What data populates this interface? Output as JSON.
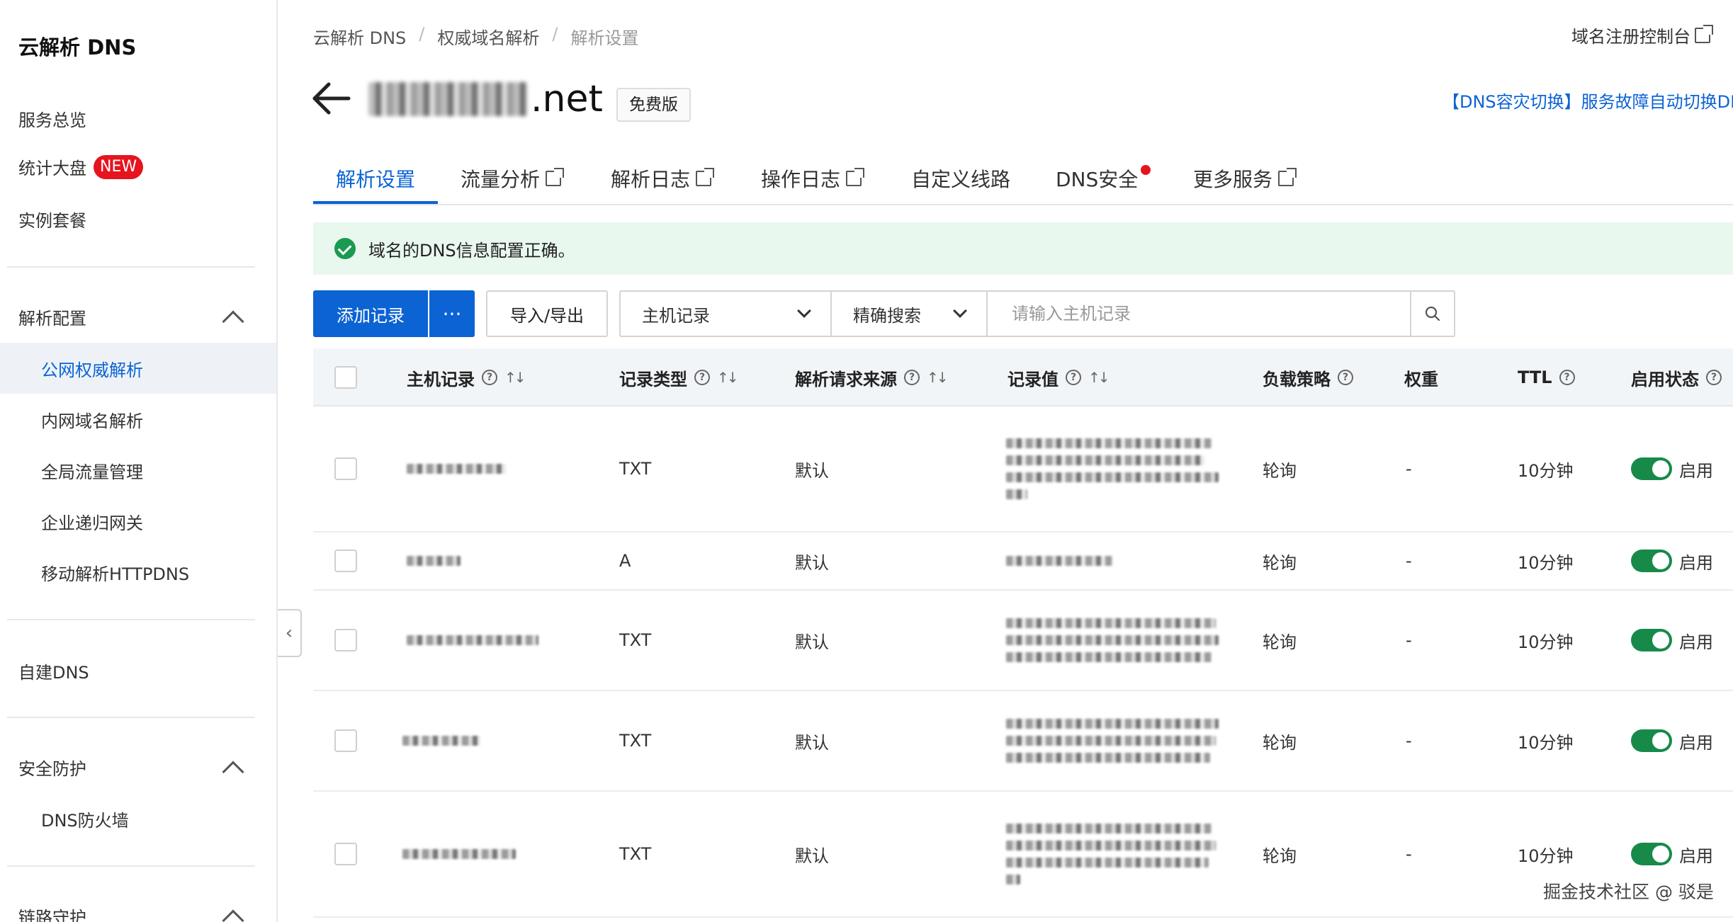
{
  "sidebar": {
    "title": "云解析 DNS",
    "top_items": [
      {
        "label": "服务总览"
      },
      {
        "label": "统计大盘",
        "badge": "NEW"
      },
      {
        "label": "实例套餐"
      }
    ],
    "group_resolve": {
      "label": "解析配置",
      "items": [
        "公网权威解析",
        "内网域名解析",
        "全局流量管理",
        "企业递归网关",
        "移动解析HTTPDNS"
      ],
      "active": "公网权威解析"
    },
    "self_dns": "自建DNS",
    "group_security": {
      "label": "安全防护",
      "items": [
        "DNS防火墙"
      ]
    },
    "group_link": {
      "label": "链路守护"
    }
  },
  "breadcrumb": [
    "云解析 DNS",
    "权威域名解析",
    "解析设置"
  ],
  "header": {
    "top_link": "域名注册控制台",
    "domain_suffix": ".net",
    "edition": "免费版",
    "promo": "【DNS容灾切换】服务故障自动切换DNS"
  },
  "tabs": [
    {
      "label": "解析设置",
      "active": true
    },
    {
      "label": "流量分析",
      "external": true
    },
    {
      "label": "解析日志",
      "external": true
    },
    {
      "label": "操作日志",
      "external": true
    },
    {
      "label": "自定义线路"
    },
    {
      "label": "DNS安全",
      "dot": true
    },
    {
      "label": "更多服务",
      "external": true
    }
  ],
  "alert": {
    "text": "域名的DNS信息配置正确。",
    "status_color": "#1a9a50"
  },
  "toolbar": {
    "add_label": "添加记录",
    "more_label": "···",
    "import_export_label": "导入/导出",
    "field_select": "主机记录",
    "mode_select": "精确搜索",
    "search_placeholder": "请输入主机记录"
  },
  "table": {
    "headers": {
      "host": "主机记录",
      "type": "记录类型",
      "source": "解析请求来源",
      "value": "记录值",
      "policy": "负载策略",
      "weight": "权重",
      "ttl": "TTL",
      "status": "启用状态"
    },
    "rows": [
      {
        "type": "TXT",
        "source": "默认",
        "policy": "轮询",
        "weight": "-",
        "ttl": "10分钟",
        "status": "启用"
      },
      {
        "type": "A",
        "source": "默认",
        "policy": "轮询",
        "weight": "-",
        "ttl": "10分钟",
        "status": "启用"
      },
      {
        "type": "TXT",
        "source": "默认",
        "policy": "轮询",
        "weight": "-",
        "ttl": "10分钟",
        "status": "启用"
      },
      {
        "type": "TXT",
        "source": "默认",
        "policy": "轮询",
        "weight": "-",
        "ttl": "10分钟",
        "status": "启用"
      },
      {
        "type": "TXT",
        "source": "默认",
        "policy": "轮询",
        "weight": "-",
        "ttl": "10分钟",
        "status": "启用"
      }
    ]
  },
  "watermark": "掘金技术社区 @ 驳是",
  "colors": {
    "accent": "#0b63d4",
    "switch_on": "#178a4a",
    "badge_new": "#e5141f",
    "alert_bg": "#e9f8ee"
  }
}
